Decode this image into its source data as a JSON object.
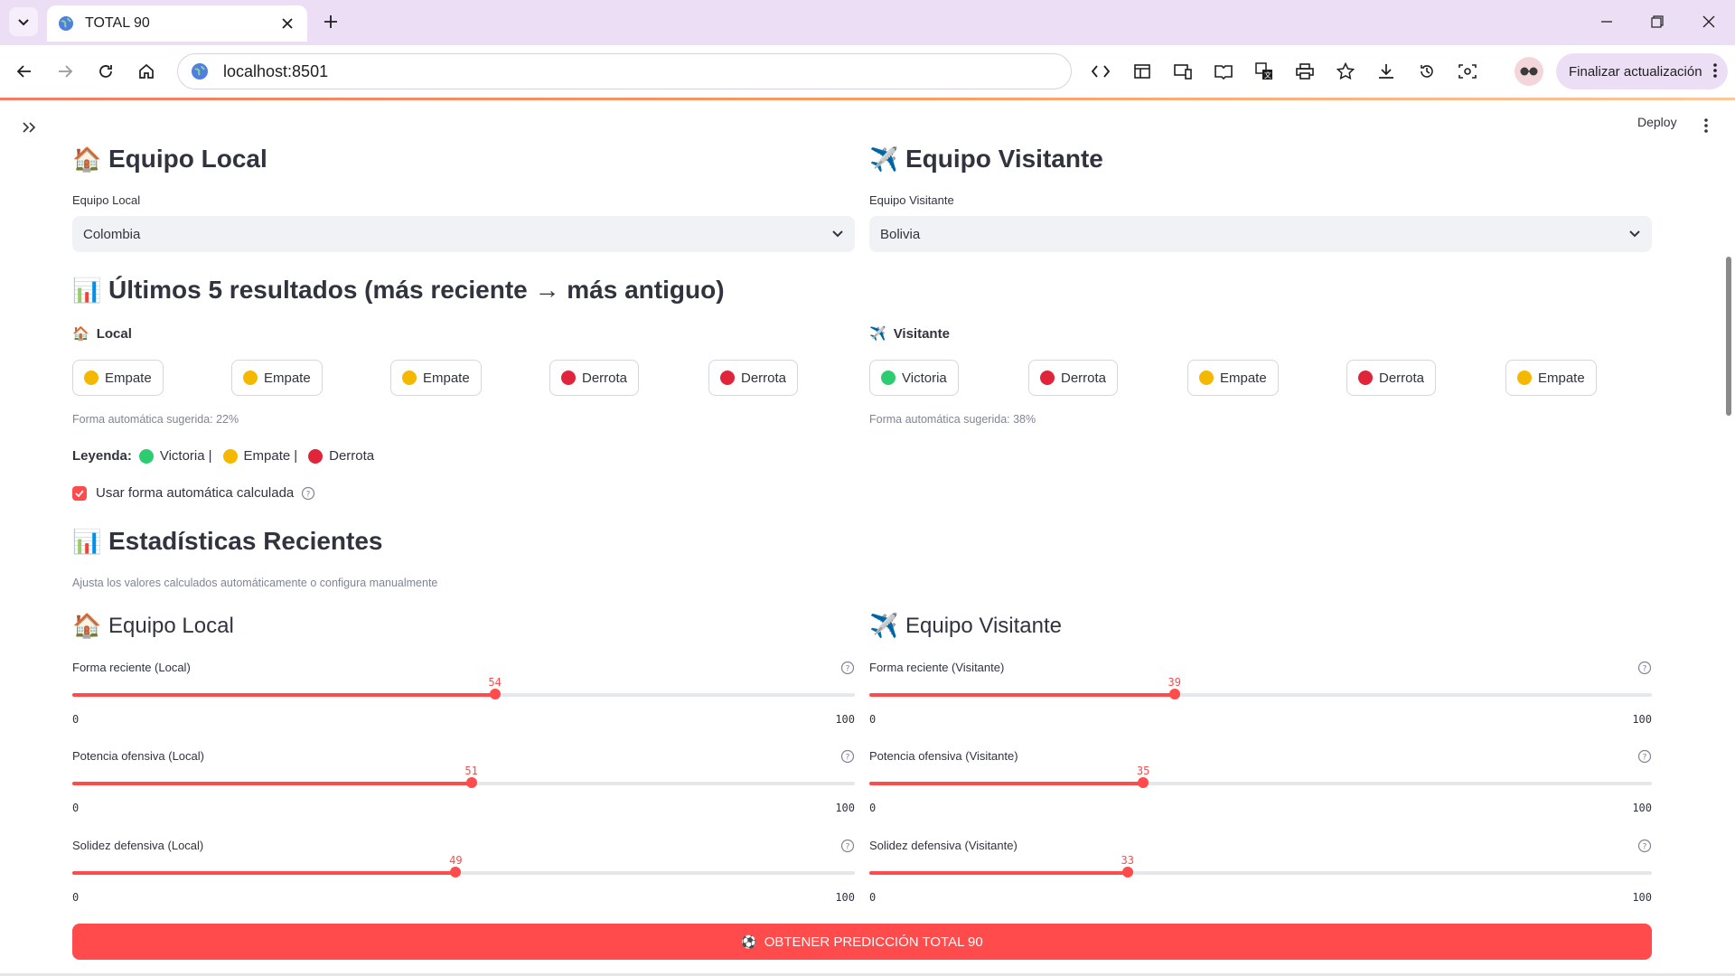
{
  "browser": {
    "tab_title": "TOTAL 90",
    "url": "localhost:8501",
    "update_button": "Finalizar actualización"
  },
  "app": {
    "deploy": "Deploy",
    "home": {
      "heading": "Equipo Local",
      "emoji": "🏠",
      "select_label": "Equipo Local",
      "select_value": "Colombia"
    },
    "away": {
      "heading": "Equipo Visitante",
      "emoji": "✈️",
      "select_label": "Equipo Visitante",
      "select_value": "Bolivia"
    },
    "results_heading": "Últimos 5 resultados (más reciente → más antiguo)",
    "results_emoji": "📊",
    "home_results": {
      "label": "Local",
      "items": [
        "Empate",
        "Empate",
        "Empate",
        "Derrota",
        "Derrota"
      ],
      "caption": "Forma automática sugerida: 22%"
    },
    "away_results": {
      "label": "Visitante",
      "items": [
        "Victoria",
        "Derrota",
        "Empate",
        "Derrota",
        "Empate"
      ],
      "caption": "Forma automática sugerida: 38%"
    },
    "legend": {
      "title": "Leyenda:",
      "victoria": "Victoria",
      "empate": "Empate",
      "derrota": "Derrota",
      "sep": "|"
    },
    "auto_checkbox": {
      "label": "Usar forma automática calculada",
      "checked": true
    },
    "stats_heading": "Estadísticas Recientes",
    "stats_caption": "Ajusta los valores calculados automáticamente o configura manualmente",
    "home_stats": {
      "heading": "Equipo Local",
      "sliders": [
        {
          "label": "Forma reciente (Local)",
          "value": 54,
          "min": 0,
          "max": 100
        },
        {
          "label": "Potencia ofensiva (Local)",
          "value": 51,
          "min": 0,
          "max": 100
        },
        {
          "label": "Solidez defensiva (Local)",
          "value": 49,
          "min": 0,
          "max": 100
        }
      ]
    },
    "away_stats": {
      "heading": "Equipo Visitante",
      "sliders": [
        {
          "label": "Forma reciente (Visitante)",
          "value": 39,
          "min": 0,
          "max": 100
        },
        {
          "label": "Potencia ofensiva (Visitante)",
          "value": 35,
          "min": 0,
          "max": 100
        },
        {
          "label": "Solidez defensiva (Visitante)",
          "value": 33,
          "min": 0,
          "max": 100
        }
      ]
    },
    "predict_button": "OBTENER PREDICCIÓN TOTAL 90",
    "predict_emoji": "⚽"
  },
  "colors": {
    "accent": "#ff4b4b",
    "victoria": "#2ecc71",
    "empate": "#f5b800",
    "derrota": "#e0243a"
  }
}
